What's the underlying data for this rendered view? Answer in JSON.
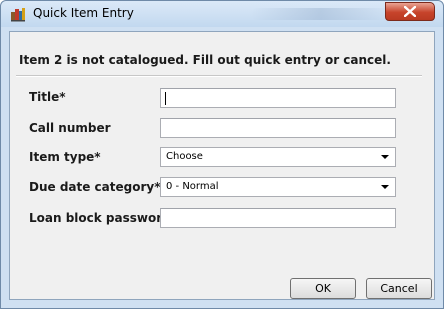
{
  "window": {
    "title": "Quick Item Entry"
  },
  "message": "Item 2 is not catalogued. Fill out quick entry or cancel.",
  "form": {
    "title_label": "Title*",
    "title_value": "",
    "call_number_label": "Call number",
    "call_number_value": "",
    "item_type_label": "Item type*",
    "item_type_value": "Choose",
    "due_date_label": "Due date category*",
    "due_date_value": "0 - Normal",
    "loan_block_label": "Loan block password",
    "loan_block_value": ""
  },
  "buttons": {
    "ok": "OK",
    "cancel": "Cancel"
  },
  "colors": {
    "titlebar": "#c2d8ef",
    "close": "#c7442b",
    "client_bg": "#f0f0f0"
  }
}
